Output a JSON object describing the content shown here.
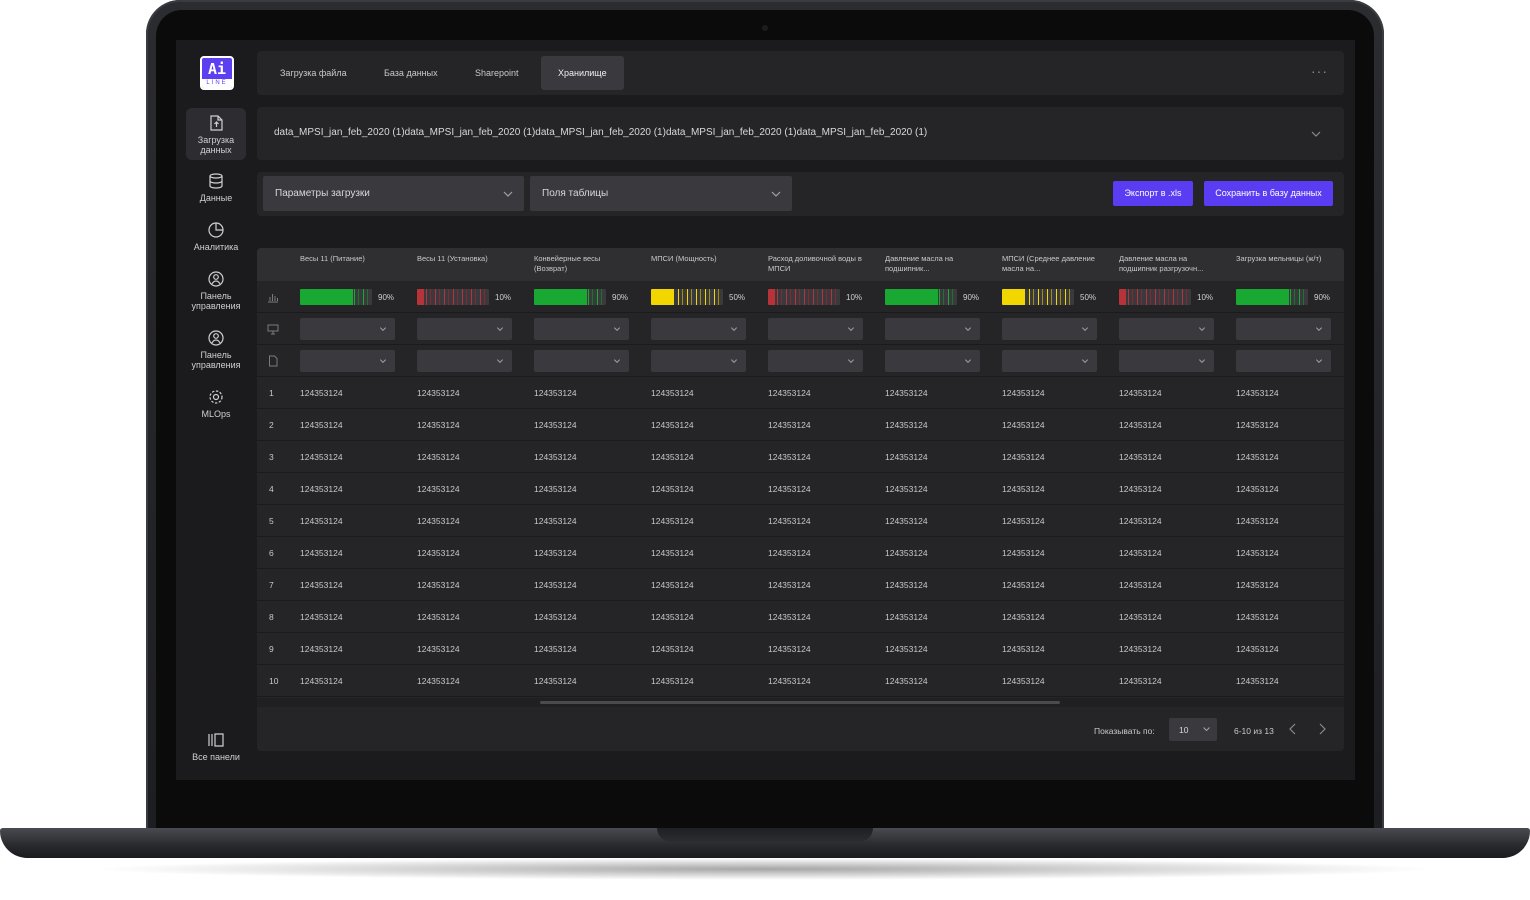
{
  "brand": {
    "logo_main": "Ai",
    "logo_sub": "LINE",
    "accent": "#5a3df2"
  },
  "sidebar": {
    "items": [
      {
        "label": "Загрузка данных",
        "icon": "file-upload-icon",
        "active": true
      },
      {
        "label": "Данные",
        "icon": "database-icon",
        "active": false
      },
      {
        "label": "Аналитика",
        "icon": "pie-chart-icon",
        "active": false
      },
      {
        "label": "Панель управления",
        "icon": "user-shield-icon",
        "active": false
      },
      {
        "label": "Панель управления",
        "icon": "user-shield-icon",
        "active": false
      },
      {
        "label": "MLOps",
        "icon": "gear-icon",
        "active": false
      }
    ],
    "bottom": {
      "label": "Все панели",
      "icon": "panels-icon"
    }
  },
  "tabs": [
    {
      "label": "Загрузка файла",
      "active": false
    },
    {
      "label": "База данных",
      "active": false
    },
    {
      "label": "Sharepoint",
      "active": false
    },
    {
      "label": "Хранилище",
      "active": true
    }
  ],
  "file": {
    "selected": "data_MPSI_jan_feb_2020 (1)data_MPSI_jan_feb_2020 (1)data_MPSI_jan_feb_2020 (1)data_MPSI_jan_feb_2020 (1)data_MPSI_jan_feb_2020 (1)"
  },
  "toolbar": {
    "params_label": "Параметры загрузки",
    "fields_label": "Поля таблицы",
    "export_label": "Экспорт в .xls",
    "save_label": "Сохранить в базу данных"
  },
  "table": {
    "columns": [
      {
        "name": "Весы 11 (Питание)",
        "quality": "90%",
        "level": 0.9,
        "color": "#19a832"
      },
      {
        "name": "Весы 11 (Установка)",
        "quality": "10%",
        "level": 0.1,
        "color": "#b8323a"
      },
      {
        "name": "Конвейерные весы (Возврат)",
        "quality": "90%",
        "level": 0.9,
        "color": "#19a832"
      },
      {
        "name": "МПСИ (Мощность)",
        "quality": "50%",
        "level": 0.5,
        "color": "#f2d600"
      },
      {
        "name": "Расход доливочной воды в МПСИ",
        "quality": "10%",
        "level": 0.1,
        "color": "#b8323a"
      },
      {
        "name": "Давление масла  на подшипник...",
        "quality": "90%",
        "level": 0.9,
        "color": "#19a832"
      },
      {
        "name": "МПСИ (Среднее давление масла на...",
        "quality": "50%",
        "level": 0.5,
        "color": "#f2d600"
      },
      {
        "name": "Давление масла на подшипник разгрузочн...",
        "quality": "10%",
        "level": 0.1,
        "color": "#b8323a"
      },
      {
        "name": "Загрузка мельницы (ж/т)",
        "quality": "90%",
        "level": 0.9,
        "color": "#19a832"
      }
    ],
    "row_icons": [
      "bar-chart-icon",
      "monitor-icon",
      "document-icon"
    ],
    "rows": [
      {
        "n": "1",
        "cells": [
          "124353124",
          "124353124",
          "124353124",
          "124353124",
          "124353124",
          "124353124",
          "124353124",
          "124353124",
          "124353124"
        ]
      },
      {
        "n": "2",
        "cells": [
          "124353124",
          "124353124",
          "124353124",
          "124353124",
          "124353124",
          "124353124",
          "124353124",
          "124353124",
          "124353124"
        ]
      },
      {
        "n": "3",
        "cells": [
          "124353124",
          "124353124",
          "124353124",
          "124353124",
          "124353124",
          "124353124",
          "124353124",
          "124353124",
          "124353124"
        ]
      },
      {
        "n": "4",
        "cells": [
          "124353124",
          "124353124",
          "124353124",
          "124353124",
          "124353124",
          "124353124",
          "124353124",
          "124353124",
          "124353124"
        ]
      },
      {
        "n": "5",
        "cells": [
          "124353124",
          "124353124",
          "124353124",
          "124353124",
          "124353124",
          "124353124",
          "124353124",
          "124353124",
          "124353124"
        ]
      },
      {
        "n": "6",
        "cells": [
          "124353124",
          "124353124",
          "124353124",
          "124353124",
          "124353124",
          "124353124",
          "124353124",
          "124353124",
          "124353124"
        ]
      },
      {
        "n": "7",
        "cells": [
          "124353124",
          "124353124",
          "124353124",
          "124353124",
          "124353124",
          "124353124",
          "124353124",
          "124353124",
          "124353124"
        ]
      },
      {
        "n": "8",
        "cells": [
          "124353124",
          "124353124",
          "124353124",
          "124353124",
          "124353124",
          "124353124",
          "124353124",
          "124353124",
          "124353124"
        ]
      },
      {
        "n": "9",
        "cells": [
          "124353124",
          "124353124",
          "124353124",
          "124353124",
          "124353124",
          "124353124",
          "124353124",
          "124353124",
          "124353124"
        ]
      },
      {
        "n": "10",
        "cells": [
          "124353124",
          "124353124",
          "124353124",
          "124353124",
          "124353124",
          "124353124",
          "124353124",
          "124353124",
          "124353124"
        ]
      }
    ]
  },
  "pagination": {
    "label": "Показывать по:",
    "page_size": "10",
    "range": "6-10 из 13"
  }
}
